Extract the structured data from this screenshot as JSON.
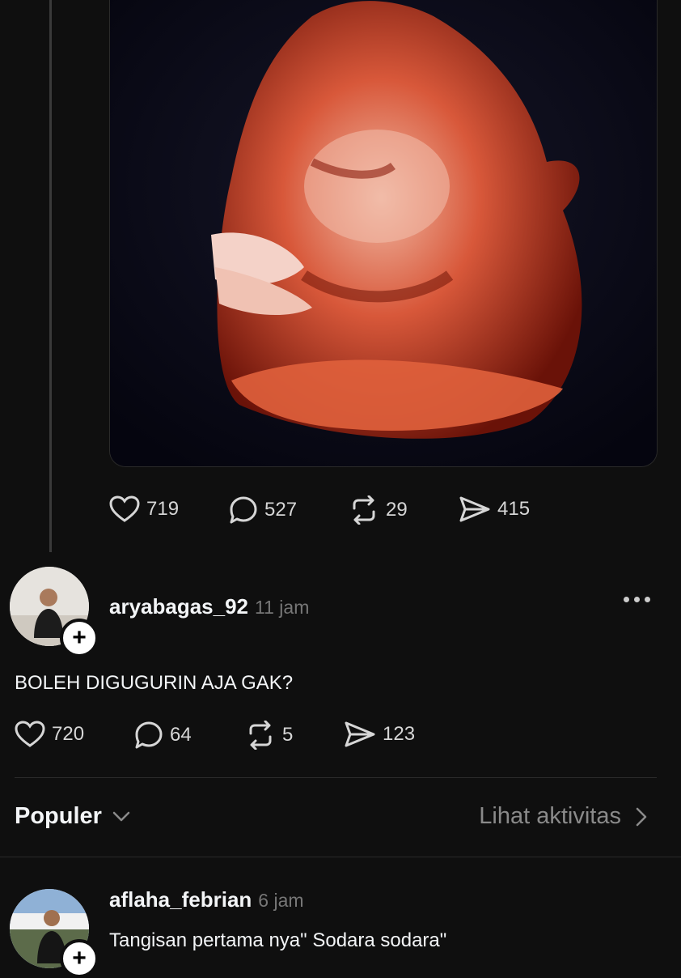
{
  "post": {
    "stats": {
      "likes": "719",
      "replies": "527",
      "reposts": "29",
      "shares": "415"
    }
  },
  "reply1": {
    "username": "aryabagas_92",
    "time": "11 jam",
    "text": "BOLEH DIGUGURIN AJA GAK?",
    "stats": {
      "likes": "720",
      "replies": "64",
      "reposts": "5",
      "shares": "123"
    }
  },
  "sort_bar": {
    "sort_label": "Populer",
    "activity_label": "Lihat aktivitas"
  },
  "reply2": {
    "username": "aflaha_febrian",
    "time": "6 jam",
    "text": "Tangisan pertama nya\" Sodara sodara\""
  },
  "icons": [
    "heart-icon",
    "reply-icon",
    "repost-icon",
    "share-icon",
    "more-icon",
    "plus-icon",
    "chevron-down-icon",
    "chevron-right-icon"
  ]
}
